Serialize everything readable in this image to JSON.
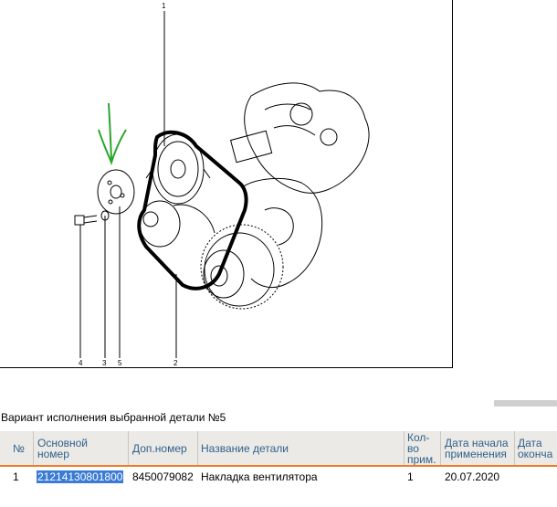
{
  "diagram": {
    "callouts": [
      "1",
      "2",
      "3",
      "4",
      "5"
    ]
  },
  "section": {
    "title": "Вариант исполнения выбранной детали №5"
  },
  "table": {
    "headers": {
      "num": "№",
      "main_number_1": "Основной",
      "main_number_2": "номер",
      "extra_number": "Доп.номер",
      "part_name": "Название детали",
      "qty_1": "Кол-",
      "qty_2": "во",
      "qty_3": "прим.",
      "start_1": "Дата начала",
      "start_2": "применения",
      "end_1": "Дата",
      "end_2": "оконча"
    },
    "rows": [
      {
        "num": "1",
        "main_number": "21214130801800",
        "extra_number": "8450079082",
        "part_name": "Накладка вентилятора",
        "qty": "1",
        "start_date": "20.07.2020",
        "end_date": ""
      }
    ]
  },
  "colors": {
    "header_text": "#30608a",
    "accent_line": "#f07a28",
    "selection": "#3a7bd5",
    "annotation": "#2aa52a"
  }
}
